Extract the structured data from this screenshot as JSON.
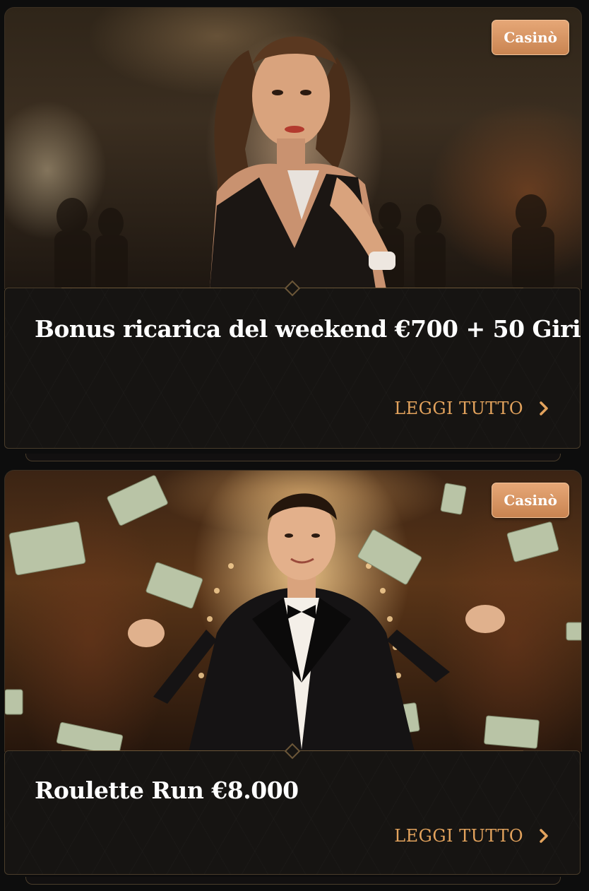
{
  "promotions": [
    {
      "category_badge": "Casinò",
      "title": "Bonus ricarica del weekend €700 + 50 Giri",
      "cta_label": "LEGGI TUTTO",
      "cta_icon": "chevron-right-icon",
      "image_subject": "woman-in-casino-image"
    },
    {
      "category_badge": "Casinò",
      "title": "Roulette Run €8.000",
      "cta_label": "LEGGI TUTTO",
      "cta_icon": "chevron-right-icon",
      "image_subject": "man-with-flying-money-image"
    }
  ],
  "theme": {
    "accent": "#e3a35d",
    "badge_bg": "#d8935f",
    "panel_bg": "#161412",
    "page_bg": "#0d0d0d"
  }
}
